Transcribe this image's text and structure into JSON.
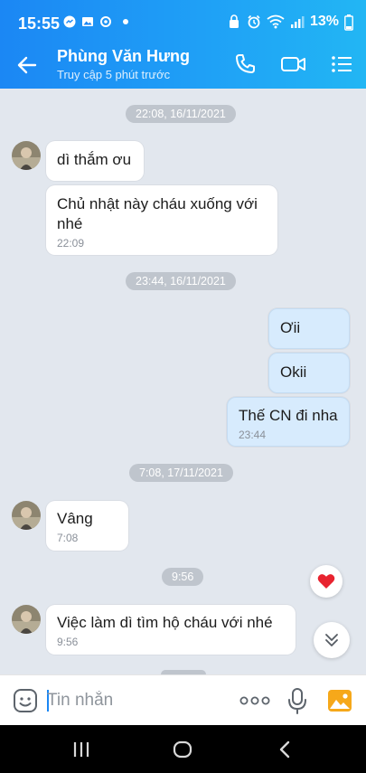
{
  "status_bar": {
    "time": "15:55",
    "battery": "13%"
  },
  "header": {
    "contact_name": "Phùng Văn Hưng",
    "last_seen": "Truy cập 5 phút trước"
  },
  "chat": {
    "timestamps": [
      "22:08, 16/11/2021",
      "23:44, 16/11/2021",
      "7:08, 17/11/2021",
      "9:56"
    ],
    "messages": [
      {
        "text": "dì thắm ơu",
        "time": ""
      },
      {
        "text": "Chủ nhật này cháu xuống với nhé",
        "time": "22:09"
      },
      {
        "text": "Ơii",
        "time": ""
      },
      {
        "text": "Okii",
        "time": ""
      },
      {
        "text": "Thế CN đi nha",
        "time": "23:44"
      },
      {
        "text": "Vâng",
        "time": "7:08"
      },
      {
        "text": "Việc làm dì tìm hộ cháu với nhé",
        "time": "9:56"
      }
    ]
  },
  "input": {
    "placeholder": "Tin nhắn"
  },
  "icons": {
    "back": "back-arrow-icon",
    "call": "phone-icon",
    "video": "video-call-icon",
    "menu": "list-menu-icon",
    "emoji": "sticker-icon",
    "more": "more-dots-icon",
    "mic": "microphone-icon",
    "image": "image-icon",
    "reaction": "heart-icon",
    "scroll": "chevron-double-down-icon"
  },
  "colors": {
    "accent": "#1b87f4",
    "outgoing_bubble": "#d7ebfd",
    "chat_bg": "#e2e7ee",
    "heart": "#e8232f"
  }
}
